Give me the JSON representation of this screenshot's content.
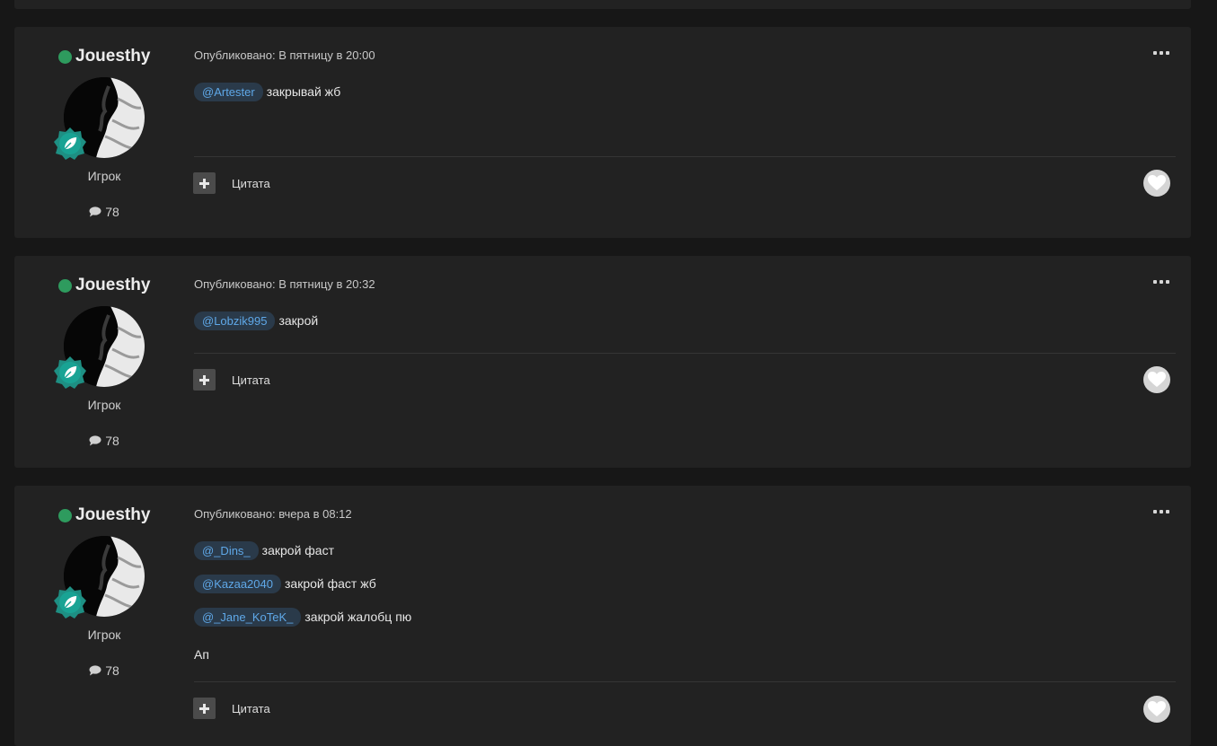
{
  "posts": [
    {
      "author": "Jouesthy",
      "rank": "Игрок",
      "post_count": "78",
      "published": "Опубликовано: В пятницу в 20:00",
      "lines": [
        {
          "mention": "@Artester",
          "text": "закрывай жб"
        }
      ],
      "quote_label": "Цитата"
    },
    {
      "author": "Jouesthy",
      "rank": "Игрок",
      "post_count": "78",
      "published": "Опубликовано: В пятницу в 20:32",
      "lines": [
        {
          "mention": "@Lobzik995",
          "text": "закрой"
        }
      ],
      "quote_label": "Цитата"
    },
    {
      "author": "Jouesthy",
      "rank": "Игрок",
      "post_count": "78",
      "published": "Опубликовано: вчера в 08:12",
      "lines": [
        {
          "mention": "@_Dins_",
          "text": "закрой фаст"
        },
        {
          "mention": "@Kazaa2040",
          "text": "закрой фаст жб"
        },
        {
          "mention": "@_Jane_KoTeK_",
          "text": "закрой жалобц пю"
        },
        {
          "text": "Ап"
        }
      ],
      "quote_label": "Цитата"
    }
  ],
  "icons": {
    "online": "online-status-dot",
    "badge": "leaf-rank-badge-icon",
    "posts": "comment-icon",
    "more": "ellipsis-icon",
    "add": "plus-icon",
    "like": "heart-icon"
  },
  "colors": {
    "background": "#171717",
    "card": "#222222",
    "online": "#2e9b5e",
    "badge": "#1e8f83",
    "mention_text": "#5fa8e8",
    "mention_bg": "#2a3a4a"
  }
}
